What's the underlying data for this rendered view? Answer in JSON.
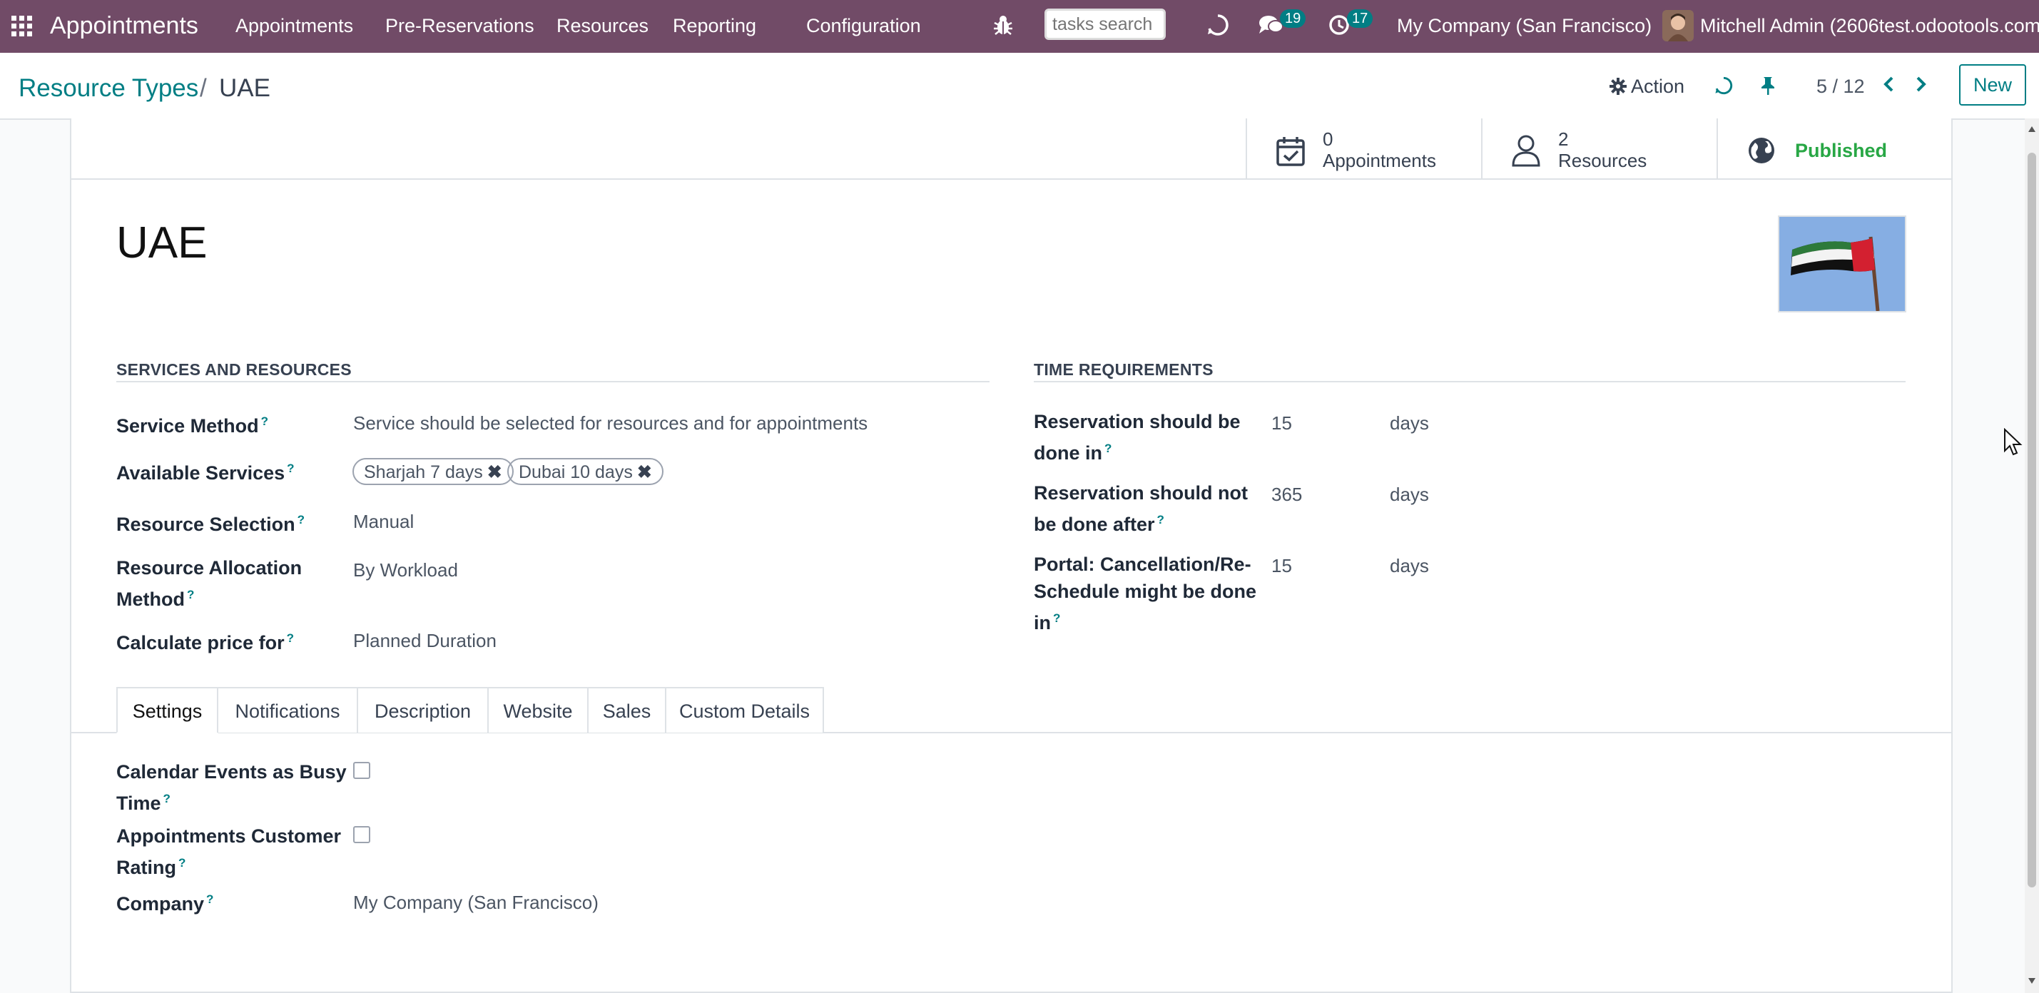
{
  "navbar": {
    "app_name": "Appointments",
    "menu": [
      "Appointments",
      "Pre-Reservations",
      "Resources",
      "Reporting",
      "Configuration"
    ],
    "search_placeholder": "tasks search",
    "messages_count": "19",
    "activities_count": "17",
    "company": "My Company (San Francisco)",
    "user": "Mitchell Admin (2606test.odootools.com)",
    "bg_color": "#714b67"
  },
  "control_panel": {
    "breadcrumb_parent": "Resource Types",
    "breadcrumb_sep": "/",
    "breadcrumb_current": "UAE",
    "action_label": "Action",
    "pager": "5 / 12",
    "new_label": "New"
  },
  "button_box": {
    "appointments_count": "0",
    "appointments_label": "Appointments",
    "resources_count": "2",
    "resources_label": "Resources",
    "published_label": "Published"
  },
  "record": {
    "title": "UAE",
    "image_icon": "uae-flag-image"
  },
  "services": {
    "heading": "SERVICES AND RESOURCES",
    "service_method_label": "Service Method",
    "service_method_value": "Service should be selected for resources and for appointments",
    "available_services_label": "Available Services",
    "available_services": [
      "Sharjah 7 days",
      "Dubai 10 days"
    ],
    "resource_selection_label": "Resource Selection",
    "resource_selection_value": "Manual",
    "allocation_label_1": "Resource Allocation",
    "allocation_label_2": "Method",
    "allocation_value": "By Workload",
    "price_label": "Calculate price for",
    "price_value": "Planned Duration"
  },
  "time": {
    "heading": "TIME REQUIREMENTS",
    "r1_label_1": "Reservation should be",
    "r1_label_2": "done in",
    "r1_value": "15",
    "r1_unit": "days",
    "r2_label_1": "Reservation should not",
    "r2_label_2": "be done after",
    "r2_value": "365",
    "r2_unit": "days",
    "r3_label_1": "Portal: Cancellation/Re-",
    "r3_label_2": "Schedule might be done",
    "r3_label_3": "in",
    "r3_value": "15",
    "r3_unit": "days"
  },
  "tabs": [
    "Settings",
    "Notifications",
    "Description",
    "Website",
    "Sales",
    "Custom Details"
  ],
  "settings": {
    "busy_label_1": "Calendar Events as Busy",
    "busy_label_2": "Time",
    "rating_label_1": "Appointments Customer",
    "rating_label_2": "Rating",
    "company_label": "Company",
    "company_value": "My Company (San Francisco)",
    "busy_checked": false,
    "rating_checked": false
  },
  "help_mark": "?",
  "colors": {
    "accent": "#017e84",
    "published": "#28a745"
  }
}
